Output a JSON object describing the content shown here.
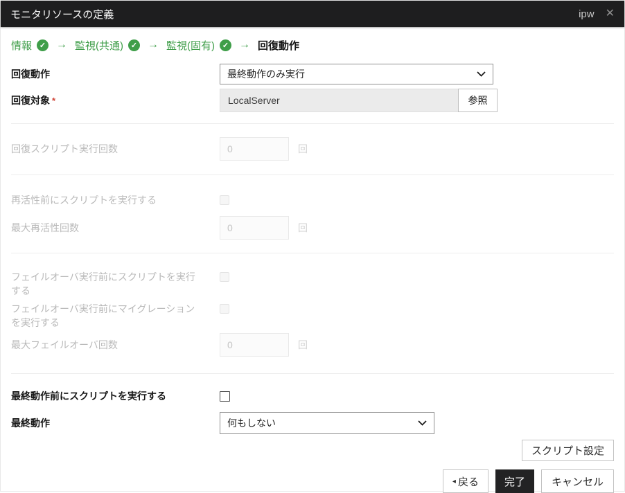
{
  "titlebar": {
    "title": "モニタリソースの定義",
    "window_label": "ipw",
    "close_icon": "✕"
  },
  "wizard": {
    "check_icon": "✓",
    "arrow_icon": "→",
    "steps": [
      {
        "label": "情報",
        "completed": true,
        "current": false
      },
      {
        "label": "監視(共通)",
        "completed": true,
        "current": false
      },
      {
        "label": "監視(固有)",
        "completed": true,
        "current": false
      },
      {
        "label": "回復動作",
        "completed": false,
        "current": true
      }
    ]
  },
  "form": {
    "recovery_action": {
      "label": "回復動作",
      "value": "最終動作のみ実行"
    },
    "recovery_target": {
      "label": "回復対象",
      "required_mark": "*",
      "value": "LocalServer",
      "browse_label": "参照"
    },
    "recovery_script_count": {
      "label": "回復スクリプト実行回数",
      "value": "0",
      "unit": "回",
      "disabled": true
    },
    "script_before_reactivation": {
      "label": "再活性前にスクリプトを実行する",
      "checked": false,
      "disabled": true
    },
    "max_reactivation_count": {
      "label": "最大再活性回数",
      "value": "0",
      "unit": "回",
      "disabled": true
    },
    "script_before_failover": {
      "label": "フェイルオーバ実行前にスクリプトを実行する",
      "checked": false,
      "disabled": true
    },
    "migration_before_failover": {
      "label": "フェイルオーバ実行前にマイグレーションを実行する",
      "checked": false,
      "disabled": true
    },
    "max_failover_count": {
      "label": "最大フェイルオーバ回数",
      "value": "0",
      "unit": "回",
      "disabled": true
    },
    "script_before_final_action": {
      "label": "最終動作前にスクリプトを実行する",
      "checked": false,
      "disabled": false
    },
    "final_action": {
      "label": "最終動作",
      "value": "何もしない"
    }
  },
  "buttons": {
    "script_settings": "スクリプト設定",
    "back_icon": "◂",
    "back": "戻る",
    "finish": "完了",
    "cancel": "キャンセル"
  },
  "colors": {
    "accent_green": "#3f9e49",
    "titlebar_bg": "#1e1e1f",
    "finish_button_bg": "#232324",
    "required_red": "#d04437",
    "disabled_text": "#b9b9b9"
  }
}
